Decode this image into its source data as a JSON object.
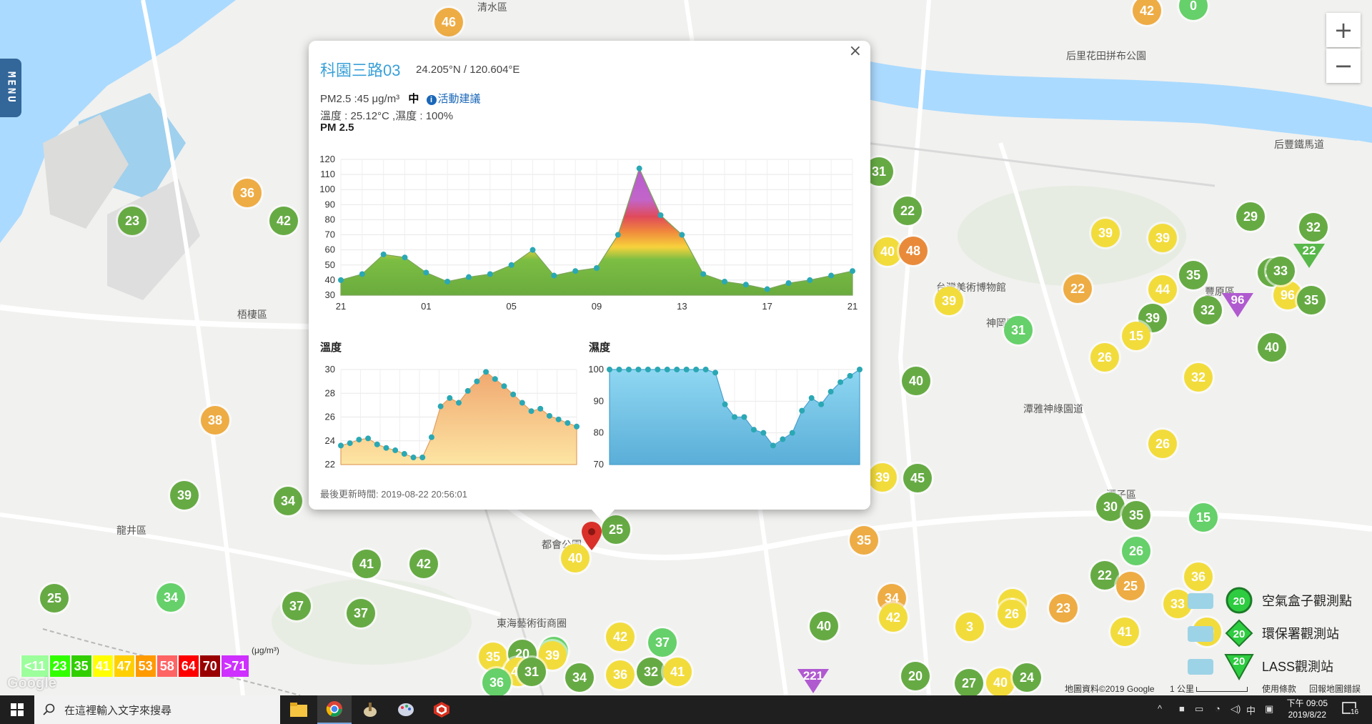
{
  "popup": {
    "title": "科園三路03",
    "coords": "24.205°N / 120.604°E",
    "close_label": "×",
    "pm_line": "PM2.5 :45 μg/m³",
    "pm_level": "中",
    "advice_link": "活動建議",
    "info_icon_text": "i",
    "temp_humid_line": "溫度 : 25.12°C ,濕度 : 100%",
    "last_updated": "最後更新時間: 2019-08-22 20:56:01"
  },
  "chart_data": [
    {
      "type": "area",
      "title": "PM 2.5",
      "x_ticks": [
        "21",
        "01",
        "05",
        "09",
        "13",
        "17",
        "21"
      ],
      "ylim": [
        30,
        120
      ],
      "y_ticks": [
        30,
        40,
        50,
        60,
        70,
        80,
        90,
        100,
        110,
        120
      ],
      "values": [
        40,
        44,
        57,
        55,
        45,
        39,
        42,
        44,
        50,
        60,
        43,
        46,
        48,
        70,
        114,
        83,
        70,
        44,
        39,
        37,
        34,
        38,
        40,
        43,
        46
      ]
    },
    {
      "type": "area",
      "title": "溫度",
      "ylim": [
        22,
        30
      ],
      "y_ticks": [
        22,
        24,
        26,
        28,
        30
      ],
      "values": [
        23.6,
        23.8,
        24.1,
        24.2,
        23.7,
        23.4,
        23.2,
        22.9,
        22.6,
        22.6,
        24.3,
        26.9,
        27.6,
        27.2,
        28.2,
        29.0,
        29.8,
        29.2,
        28.6,
        27.9,
        27.2,
        26.5,
        26.7,
        26.1,
        25.8,
        25.5,
        25.2
      ]
    },
    {
      "type": "area",
      "title": "濕度",
      "ylim": [
        70,
        100
      ],
      "y_ticks": [
        70,
        80,
        90,
        100
      ],
      "values": [
        100,
        100,
        100,
        100,
        100,
        100,
        100,
        100,
        100,
        100,
        100,
        99,
        89,
        85,
        85,
        81,
        80,
        76,
        78,
        80,
        87,
        91,
        89,
        93,
        96,
        98,
        100
      ]
    }
  ],
  "menu_label": "MENU",
  "zoom": {
    "in": "+",
    "out": "−"
  },
  "aqi_legend": {
    "unit": "(μg/m³)",
    "items": [
      {
        "label": "<11",
        "color": "#9cff9c"
      },
      {
        "label": "23",
        "color": "#31ff00"
      },
      {
        "label": "35",
        "color": "#31cf00"
      },
      {
        "label": "41",
        "color": "#ffff00"
      },
      {
        "label": "47",
        "color": "#ffcf00"
      },
      {
        "label": "53",
        "color": "#ff9a00"
      },
      {
        "label": "58",
        "color": "#ff6464"
      },
      {
        "label": "64",
        "color": "#ff0000"
      },
      {
        "label": "70",
        "color": "#990000"
      },
      {
        "label": ">71",
        "color": "#ce30ff"
      }
    ]
  },
  "marker_legend": [
    {
      "label": "空氣盒子觀測點",
      "value": "20",
      "icon": "cloud-icon"
    },
    {
      "label": "環保署觀測站",
      "value": "20",
      "icon": "building-icon"
    },
    {
      "label": "LASS觀測站",
      "value": "20",
      "icon": "fountain-icon"
    }
  ],
  "google_logo": "Google",
  "attribution": {
    "map_data": "地圖資料©2019 Google",
    "scale": "1 公里",
    "terms": "使用條款",
    "report": "回報地圖錯誤"
  },
  "places": [
    "清水區",
    "梧棲區",
    "龍井區",
    "神岡區",
    "后里花田拼布公園",
    "后豐鐵馬道",
    "台灣美術博物館",
    "潭雅神綠園道",
    "潭子區",
    "東海藝術街商圈",
    "都會公園",
    "豐原區"
  ],
  "markers": [
    "46",
    "42",
    "0",
    "31",
    "22",
    "40",
    "48",
    "29",
    "32",
    "39",
    "39",
    "22",
    "35",
    "44",
    "39",
    "23",
    "32",
    "96",
    "36",
    "42",
    "23",
    "31",
    "39",
    "15",
    "26",
    "40",
    "40",
    "32",
    "26",
    "39",
    "45",
    "38",
    "39",
    "34",
    "30",
    "35",
    "26",
    "22",
    "25",
    "41",
    "42",
    "35",
    "33",
    "2",
    "34",
    "42",
    "23",
    "26",
    "19",
    "25",
    "34",
    "37",
    "37",
    "42",
    "41",
    "3",
    "40",
    "36",
    "25",
    "40",
    "32",
    "37",
    "39",
    "35",
    "20",
    "40",
    "31",
    "34",
    "36",
    "32",
    "41",
    "36",
    "20",
    "27",
    "40",
    "24",
    "35",
    "33",
    "15"
  ],
  "triangle_markers": [
    "22",
    "96",
    "221"
  ],
  "taskbar": {
    "search_placeholder": "在這裡輸入文字來搜尋",
    "time": "下午 09:05",
    "date": "2019/8/22",
    "ime": "中",
    "notification_count": "16"
  },
  "colors": {
    "green": "#66aa44",
    "lightgreen": "#66d06a",
    "yellow": "#f2dc3c",
    "orange": "#eeac44",
    "darkorange": "#e98a3a",
    "purple": "#b05ad0"
  }
}
